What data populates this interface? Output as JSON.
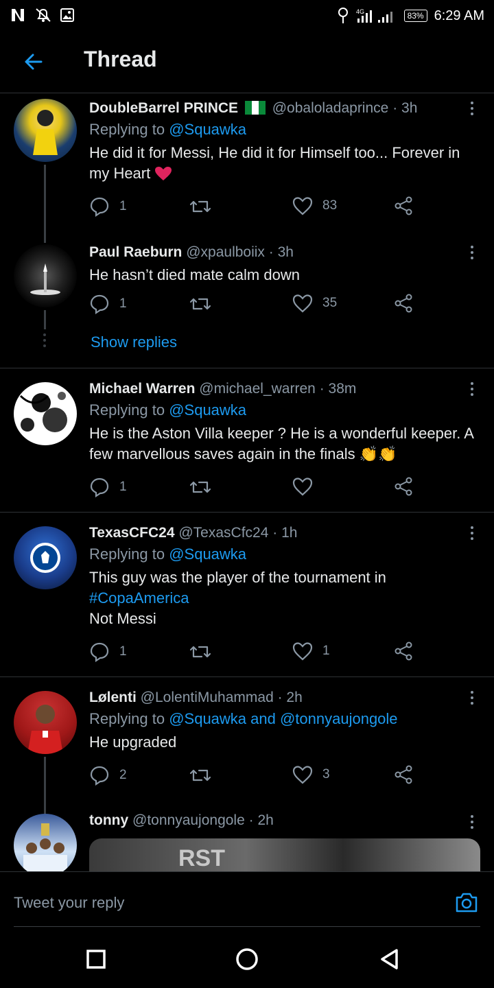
{
  "status_bar": {
    "time": "6:29 AM",
    "battery": "83%",
    "network": "4G",
    "icons": [
      "netflix-icon",
      "notifications-off-icon",
      "gallery-icon",
      "location-icon",
      "signal-icon",
      "battery-icon"
    ]
  },
  "header": {
    "title": "Thread",
    "back_icon": "back-arrow-icon"
  },
  "tweets": [
    {
      "name": "DoubleBarrel PRINCE",
      "flag": "🇳🇬",
      "handle": "@obaloladaprince",
      "time": "· 3h",
      "replying_prefix": "Replying to",
      "replying_to": "@Squawka",
      "text": "He did it for Messi, He did it for Himself too... Forever in my Heart",
      "emoji": "❤️",
      "replies": "1",
      "retweets": "",
      "likes": "83"
    },
    {
      "name": "Paul Raeburn",
      "handle": "@xpaulboiix",
      "time": "· 3h",
      "text": "He hasn’t died mate calm down",
      "replies": "1",
      "retweets": "",
      "likes": "35",
      "show_replies": "Show replies"
    },
    {
      "name": "Michael Warren",
      "handle": "@michael_warren",
      "time": "· 38m",
      "replying_prefix": "Replying to",
      "replying_to": "@Squawka",
      "text": "He is the Aston Villa keeper ? He is a wonderful keeper. A few marvellous saves again in the finals",
      "emoji": "👏👏",
      "replies": "1",
      "retweets": "",
      "likes": ""
    },
    {
      "name": "TexasCFC24",
      "handle": "@TexasCfc24",
      "time": "· 1h",
      "replying_prefix": "Replying to",
      "replying_to": "@Squawka",
      "text_line1": "This guy was the player of the tournament in",
      "hashtag": "#CopaAmerica",
      "text_line3": "Not Messi",
      "replies": "1",
      "retweets": "",
      "likes": "1"
    },
    {
      "name": "Lølenti",
      "handle": "@LolentiMuhammad",
      "time": "· 2h",
      "replying_prefix": "Replying to",
      "replying_to": "@Squawka and @tonnyaujongole",
      "text": "He upgraded",
      "replies": "2",
      "retweets": "",
      "likes": "3"
    },
    {
      "name": "tonny",
      "handle": "@tonnyaujongole",
      "time": "· 2h",
      "media_text": "RST"
    }
  ],
  "reply_bar": {
    "placeholder": "Tweet your reply",
    "camera_icon": "camera-icon"
  },
  "colors": {
    "background": "#000000",
    "text": "#e7e9ea",
    "secondary": "#8b98a5",
    "accent": "#1d9bf0",
    "divider": "#2f3336"
  }
}
